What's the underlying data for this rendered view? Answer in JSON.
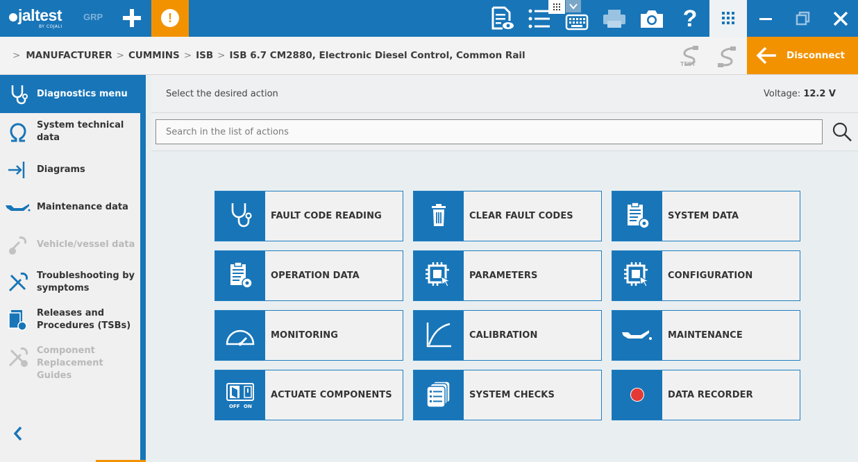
{
  "app": {
    "brand": "jaltest",
    "brand_sub": "BY COJALI",
    "grp_label": "GRP",
    "alert_glyph": "!",
    "help_glyph": "?",
    "colors": {
      "primary": "#1875b8",
      "accent": "#f39200",
      "background": "#e9eff1"
    }
  },
  "toolbar": {
    "icons": [
      "document-view-icon",
      "checklist-icon",
      "keyboard-icon",
      "printer-icon",
      "camera-icon",
      "help-icon",
      "apps-grid-icon"
    ],
    "window_controls": [
      "minimize-icon",
      "restore-icon",
      "close-icon"
    ]
  },
  "breadcrumb": {
    "items": [
      "MANUFACTURER",
      "CUMMINS",
      "ISB",
      "ISB 6.7 CM2880, Electronic Diesel Control, Common Rail"
    ]
  },
  "test_label": "TEST",
  "disconnect_label": "Disconnect",
  "sidebar": {
    "items": [
      {
        "label": "Diagnostics menu",
        "icon": "stethoscope-icon",
        "state": "active"
      },
      {
        "label": "System technical data",
        "icon": "omega-icon",
        "state": "normal"
      },
      {
        "label": "Diagrams",
        "icon": "diagram-icon",
        "state": "normal"
      },
      {
        "label": "Maintenance data",
        "icon": "oil-can-icon",
        "state": "normal"
      },
      {
        "label": "Vehicle/vessel data",
        "icon": "wrench-globe-icon",
        "state": "disabled"
      },
      {
        "label": "Troubleshooting by symptoms",
        "icon": "tools-icon",
        "state": "normal"
      },
      {
        "label": "Releases and Procedures (TSBs)",
        "icon": "documents-globe-icon",
        "state": "normal"
      },
      {
        "label": "Component Replacement Guides",
        "icon": "tools-gear-icon",
        "state": "disabled"
      }
    ]
  },
  "main": {
    "hint": "Select the desired action",
    "voltage_label": "Voltage:",
    "voltage_value": "12.2 V",
    "search_placeholder": "Search in the list of actions",
    "search_value": ""
  },
  "actions": [
    {
      "label": "FAULT CODE READING",
      "icon": "stethoscope-icon"
    },
    {
      "label": "CLEAR FAULT CODES",
      "icon": "trash-icon"
    },
    {
      "label": "SYSTEM DATA",
      "icon": "clipboard-gear-icon"
    },
    {
      "label": "OPERATION DATA",
      "icon": "clipboard-gear-icon"
    },
    {
      "label": "PARAMETERS",
      "icon": "chip-cursor-icon"
    },
    {
      "label": "CONFIGURATION",
      "icon": "chip-cursor-icon"
    },
    {
      "label": "MONITORING",
      "icon": "gauge-icon"
    },
    {
      "label": "CALIBRATION",
      "icon": "curve-chart-icon"
    },
    {
      "label": "MAINTENANCE",
      "icon": "oil-can-icon"
    },
    {
      "label": "ACTUATE COMPONENTS",
      "icon": "switch-off-on-icon",
      "icon_text": [
        "OFF",
        "ON"
      ]
    },
    {
      "label": "SYSTEM CHECKS",
      "icon": "checklist-stack-icon"
    },
    {
      "label": "DATA RECORDER",
      "icon": "record-icon",
      "icon_color": "#e53935"
    }
  ]
}
